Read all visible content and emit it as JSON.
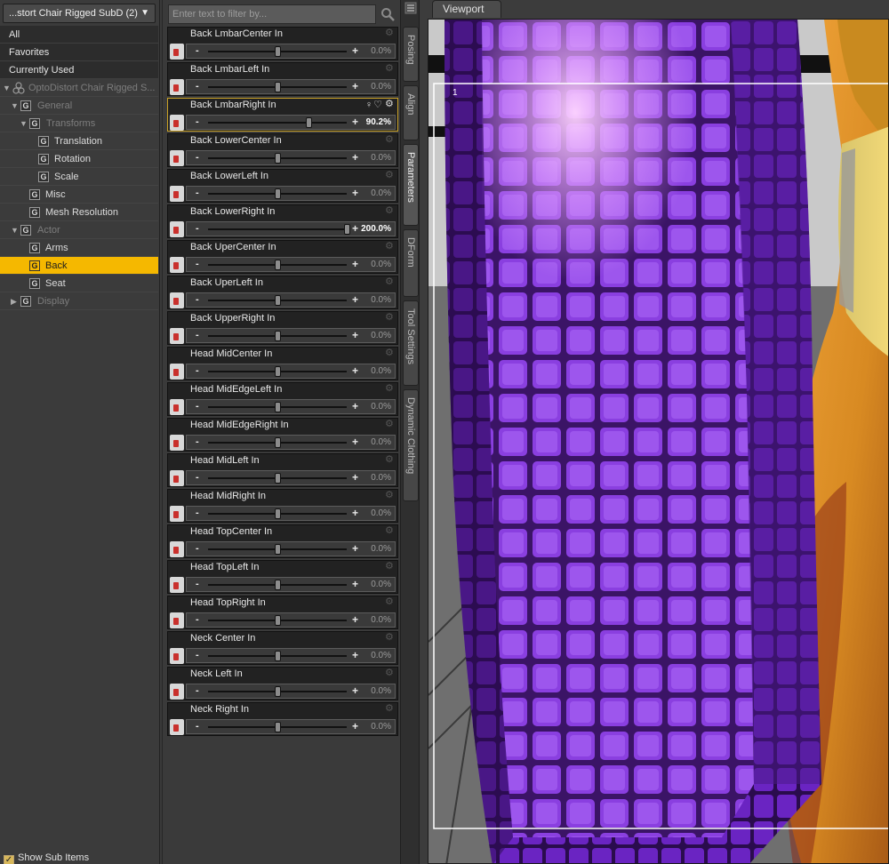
{
  "tree": {
    "node_select": "...stort Chair Rigged SubD (2)",
    "groups": [
      "All",
      "Favorites",
      "Currently Used"
    ],
    "root": "OptoDistort Chair Rigged S...",
    "items": [
      {
        "label": "General",
        "dim": true
      },
      {
        "label": "Transforms",
        "dim": true
      },
      {
        "label": "Translation"
      },
      {
        "label": "Rotation"
      },
      {
        "label": "Scale"
      },
      {
        "label": "Misc"
      },
      {
        "label": "Mesh Resolution"
      },
      {
        "label": "Actor",
        "dim": true
      },
      {
        "label": "Arms"
      },
      {
        "label": "Back",
        "selected": true
      },
      {
        "label": "Seat"
      },
      {
        "label": "Display",
        "dim": true
      }
    ],
    "show_sub_items": "Show Sub Items"
  },
  "params": {
    "filter_placeholder": "Enter text to filter by...",
    "list": [
      {
        "name": "Back LmbarCenter In",
        "value": "0.0%",
        "pct": 0.0
      },
      {
        "name": "Back LmbarLeft In",
        "value": "0.0%",
        "pct": 0.0
      },
      {
        "name": "Back LmbarRight In",
        "value": "90.2%",
        "pct": 90.2,
        "active": true
      },
      {
        "name": "Back LowerCenter In",
        "value": "0.0%",
        "pct": 0.0
      },
      {
        "name": "Back LowerLeft In",
        "value": "0.0%",
        "pct": 0.0
      },
      {
        "name": "Back LowerRight In",
        "value": "200.0%",
        "pct": 200.0,
        "hot": true
      },
      {
        "name": "Back UperCenter In",
        "value": "0.0%",
        "pct": 0.0
      },
      {
        "name": "Back UperLeft In",
        "value": "0.0%",
        "pct": 0.0
      },
      {
        "name": "Back UpperRight In",
        "value": "0.0%",
        "pct": 0.0
      },
      {
        "name": "Head MidCenter In",
        "value": "0.0%",
        "pct": 0.0
      },
      {
        "name": "Head MidEdgeLeft In",
        "value": "0.0%",
        "pct": 0.0
      },
      {
        "name": "Head MidEdgeRight In",
        "value": "0.0%",
        "pct": 0.0
      },
      {
        "name": "Head MidLeft In",
        "value": "0.0%",
        "pct": 0.0
      },
      {
        "name": "Head MidRight In",
        "value": "0.0%",
        "pct": 0.0
      },
      {
        "name": "Head TopCenter In",
        "value": "0.0%",
        "pct": 0.0
      },
      {
        "name": "Head TopLeft In",
        "value": "0.0%",
        "pct": 0.0
      },
      {
        "name": "Head TopRight In",
        "value": "0.0%",
        "pct": 0.0
      },
      {
        "name": "Neck Center In",
        "value": "0.0%",
        "pct": 0.0
      },
      {
        "name": "Neck Left In",
        "value": "0.0%",
        "pct": 0.0
      },
      {
        "name": "Neck Right In",
        "value": "0.0%",
        "pct": 0.0
      }
    ],
    "slider_min_label": "-",
    "slider_max_label": "+"
  },
  "tabs": [
    "Posing",
    "Align",
    "Parameters",
    "DForm",
    "Tool Settings",
    "Dynamic Clothing"
  ],
  "active_tab": "Parameters",
  "viewport": {
    "tab_label": "Viewport",
    "camera_label": "1"
  },
  "colors": {
    "selection": "#f5b800",
    "mesh_purple": "#7a2fd0",
    "mesh_glow": "#e7a6ff",
    "skin_orange": "#d68a24"
  }
}
